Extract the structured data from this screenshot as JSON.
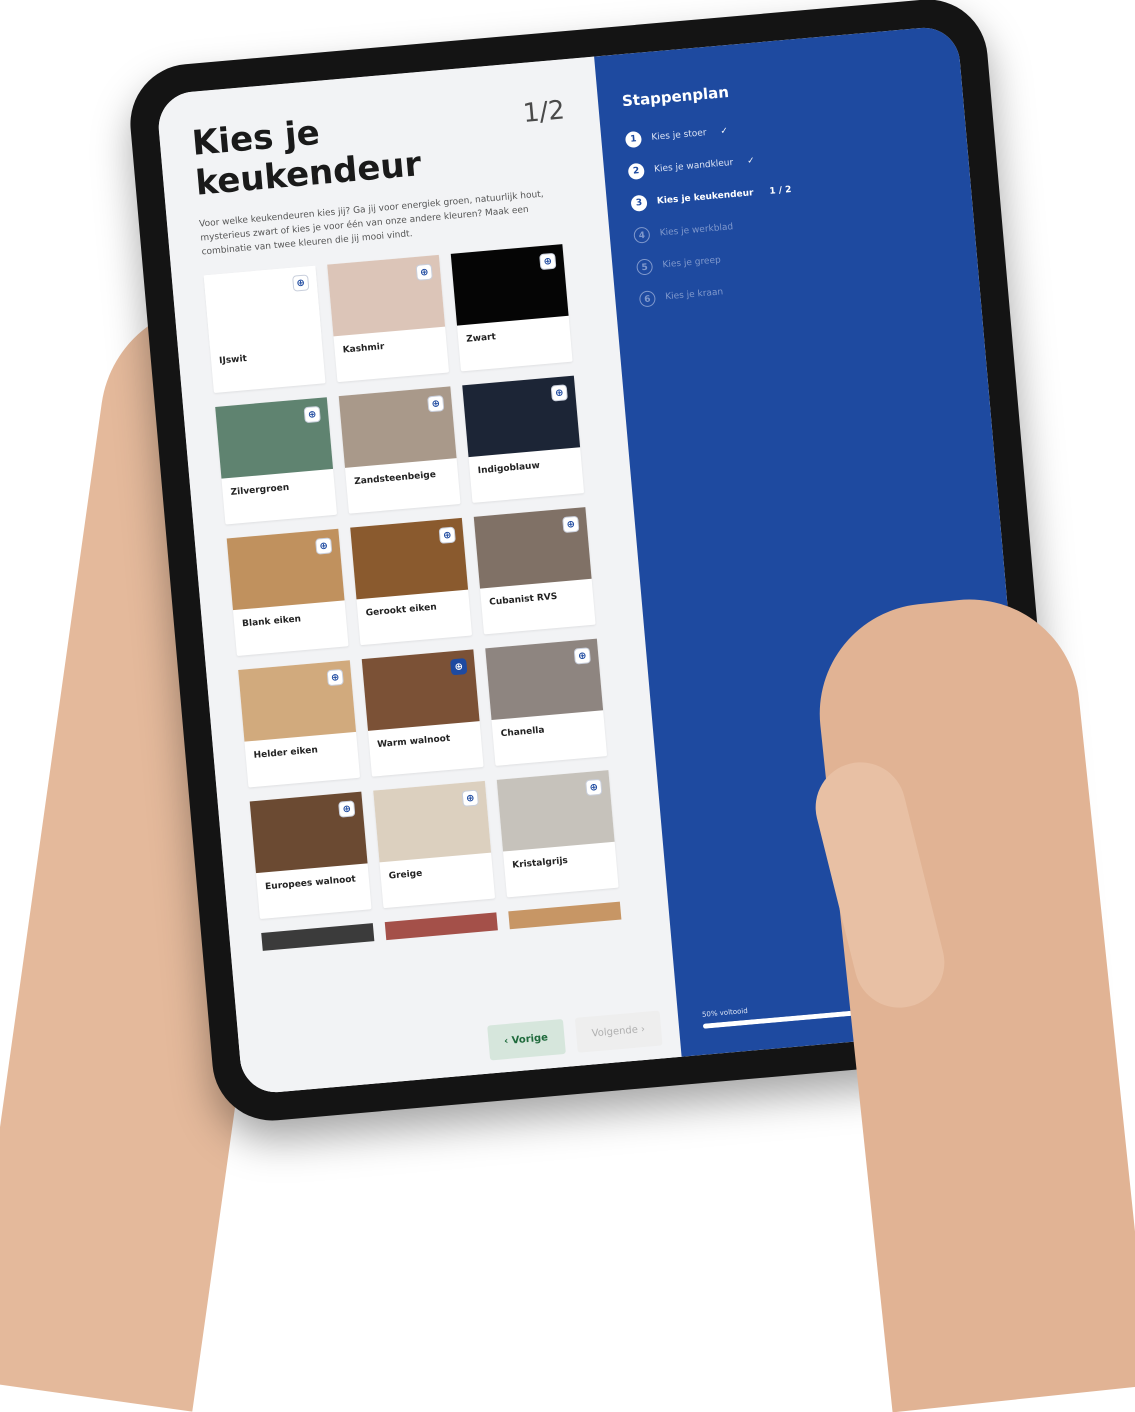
{
  "main": {
    "title": "Kies je keukendeur",
    "counter": "1/2",
    "intro": "Voor welke keukendeuren kies jij? Ga jij voor energiek groen, natuurlijk hout, mysterieus zwart of kies je voor één van onze andere kleuren? Maak een combinatie van twee kleuren die jij mooi vindt."
  },
  "doors": [
    {
      "label": "IJswit",
      "color": "#ffffff",
      "active": false
    },
    {
      "label": "Kashmir",
      "color": "#dcc5b8",
      "active": false
    },
    {
      "label": "Zwart",
      "color": "#050505",
      "active": false
    },
    {
      "label": "Zilvergroen",
      "color": "#5f8370",
      "active": false
    },
    {
      "label": "Zandsteenbeige",
      "color": "#a9998a",
      "active": false
    },
    {
      "label": "Indigoblauw",
      "color": "#1c2536",
      "active": false
    },
    {
      "label": "Blank eiken",
      "color": "#c0915e",
      "active": false
    },
    {
      "label": "Gerookt eiken",
      "color": "#8a5a2e",
      "active": false
    },
    {
      "label": "Cubanist RVS",
      "color": "#807166",
      "active": false
    },
    {
      "label": "Helder eiken",
      "color": "#d1aa7d",
      "active": false
    },
    {
      "label": "Warm walnoot",
      "color": "#7b5136",
      "active": true
    },
    {
      "label": "Chanella",
      "color": "#8e8580",
      "active": false
    },
    {
      "label": "Europees walnoot",
      "color": "#6b4a32",
      "active": false
    },
    {
      "label": "Greige",
      "color": "#dcd0bf",
      "active": false
    },
    {
      "label": "Kristalgrijs",
      "color": "#c6c2bb",
      "active": false
    }
  ],
  "partial_row": [
    "#3b3b3b",
    "#a45049",
    "#c79665"
  ],
  "info_icon_glyph": "⊕",
  "buttons": {
    "prev": "‹ Vorige",
    "next": "Volgende ›"
  },
  "sidebar": {
    "title": "Stappenplan",
    "steps": [
      {
        "num": "1",
        "label": "Kies je stoer",
        "state": "done",
        "mark": "✓"
      },
      {
        "num": "2",
        "label": "Kies je wandkleur",
        "state": "done",
        "mark": "✓"
      },
      {
        "num": "3",
        "label": "Kies je keukendeur",
        "state": "current",
        "count": "1 / 2"
      },
      {
        "num": "4",
        "label": "Kies je werkblad",
        "state": "future"
      },
      {
        "num": "5",
        "label": "Kies je greep",
        "state": "future"
      },
      {
        "num": "6",
        "label": "Kies je kraan",
        "state": "future"
      }
    ],
    "progress_label": "50% voltooid",
    "progress_value": 0.5
  },
  "colors": {
    "brand_blue": "#1e4aa0",
    "prev_button_bg": "#d6e6dc"
  }
}
